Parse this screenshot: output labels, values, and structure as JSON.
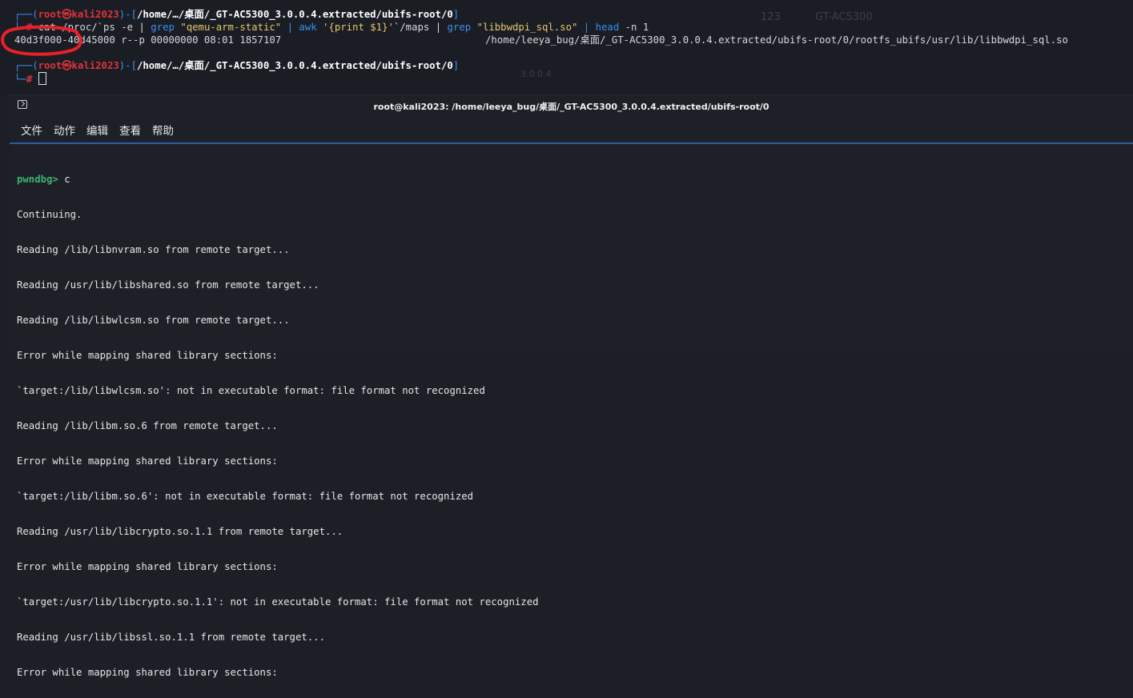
{
  "bg_terminal": {
    "prompt1": {
      "open": "┌──(",
      "user": "root㉿kali2023",
      "mid": ")-[",
      "path": "/home/…/桌面/_GT-AC5300_3.0.0.4.extracted/ubifs-root/0",
      "close": "]"
    },
    "cmd_line": {
      "lead": "└─",
      "hash": "# ",
      "cat": "cat /proc/`ps -e | ",
      "grep1": "grep ",
      "arg1": "\"qemu-arm-static\"",
      "pipe1": " | ",
      "awk": "awk ",
      "arg2": "'{print $1}'",
      "maps": "`/maps | ",
      "grep2": "grep ",
      "arg3": "\"libbwdpi_sql.so\"",
      "pipe2": " | ",
      "head": "head ",
      "headarg": "-n 1"
    },
    "maps_line": {
      "range": "40d3f000-40d45000",
      "perms": " r--p 00000000 08:01 1857107",
      "file": "/home/leeya_bug/桌面/_GT-AC5300_3.0.0.4.extracted/ubifs-root/0/rootfs_ubifs/usr/lib/libbwdpi_sql.so"
    },
    "prompt2": {
      "open": "┌──(",
      "user": "root㉿kali2023",
      "mid": ")-[",
      "path": "/home/…/桌面/_GT-AC5300_3.0.0.4.extracted/ubifs-root/0",
      "close": "]"
    },
    "prompt2_lead": "└─",
    "prompt2_hash": "# ",
    "ghost_text_1": "123",
    "ghost_text_2": "GT-AC5300",
    "ghost_text_3": "3.0.0.4"
  },
  "window": {
    "title": "root@kali2023: /home/leeya_bug/桌面/_GT-AC5300_3.0.0.4.extracted/ubifs-root/0",
    "menu": [
      "文件",
      "动作",
      "编辑",
      "查看",
      "帮助"
    ]
  },
  "output": {
    "prompt": "pwndbg>",
    "command": " c",
    "lines": [
      "Continuing.",
      "Reading /lib/libnvram.so from remote target...",
      "Reading /usr/lib/libshared.so from remote target...",
      "Reading /lib/libwlcsm.so from remote target...",
      "Error while mapping shared library sections:",
      "`target:/lib/libwlcsm.so': not in executable format: file format not recognized",
      "Reading /lib/libm.so.6 from remote target...",
      "Error while mapping shared library sections:",
      "`target:/lib/libm.so.6': not in executable format: file format not recognized",
      "Reading /usr/lib/libcrypto.so.1.1 from remote target...",
      "Error while mapping shared library sections:",
      "`target:/usr/lib/libcrypto.so.1.1': not in executable format: file format not recognized",
      "Reading /usr/lib/libssl.so.1.1 from remote target...",
      "Error while mapping shared library sections:"
    ]
  },
  "colors": {
    "accent_blue": "#3b8eea",
    "prompt_red": "#e0323a",
    "pwndbg_green": "#3cb371",
    "annotation_red": "#e8202a",
    "menu_underline": "#2f5aa8"
  }
}
